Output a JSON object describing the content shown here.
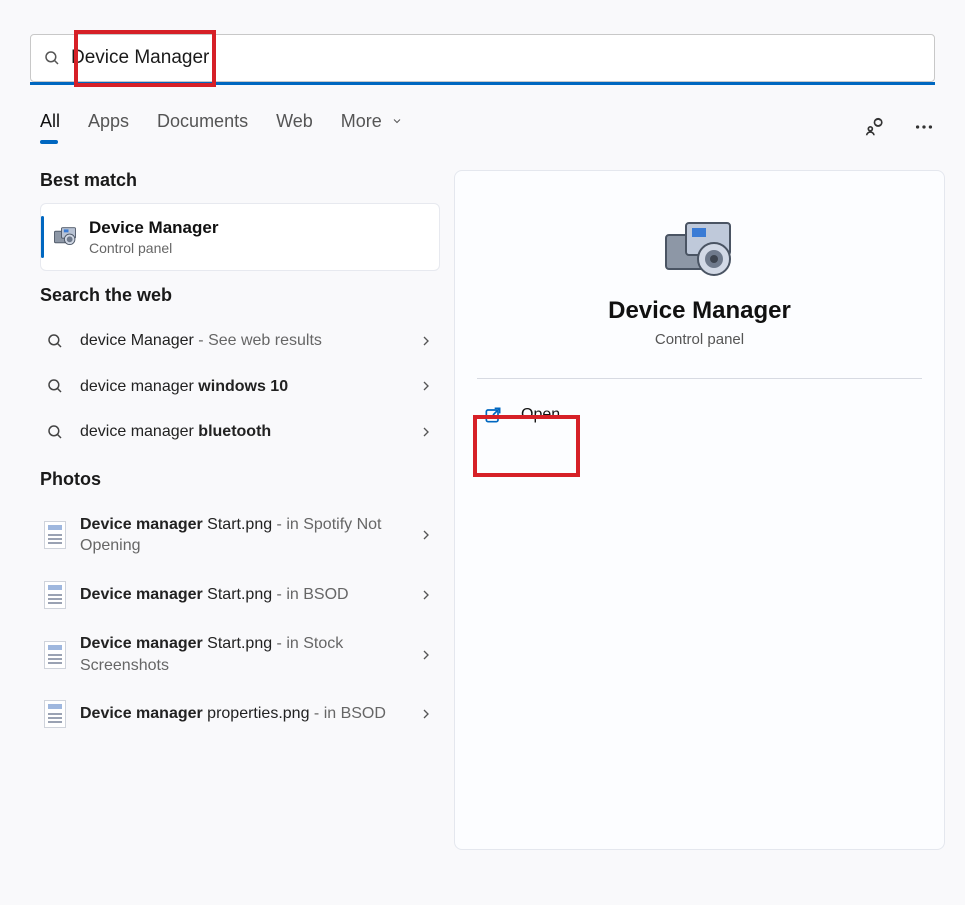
{
  "search": {
    "value": "Device Manager"
  },
  "tabs": {
    "all": "All",
    "apps": "Apps",
    "documents": "Documents",
    "web": "Web",
    "more": "More"
  },
  "aux_icons": {
    "people": "people-sync-icon",
    "more": "more-horizontal-icon"
  },
  "sections": {
    "best_match": "Best match",
    "search_web": "Search the web",
    "photos": "Photos"
  },
  "best_match": {
    "title": "Device Manager",
    "subtitle": "Control panel"
  },
  "web_results": [
    {
      "prefix": "device Manager",
      "bold": "",
      "suffix": " - See web results"
    },
    {
      "prefix": "device manager ",
      "bold": "windows 10",
      "suffix": ""
    },
    {
      "prefix": "device manager ",
      "bold": "bluetooth",
      "suffix": ""
    }
  ],
  "photos": [
    {
      "name_bold": "Device manager",
      "name_rest": " Start.png",
      "loc": " - in Spotify Not Opening"
    },
    {
      "name_bold": "Device manager",
      "name_rest": " Start.png",
      "loc": " - in BSOD"
    },
    {
      "name_bold": "Device manager",
      "name_rest": " Start.png",
      "loc": " - in Stock Screenshots"
    },
    {
      "name_bold": "Device manager",
      "name_rest": " properties.png",
      "loc": " - in BSOD"
    }
  ],
  "preview": {
    "title": "Device Manager",
    "subtitle": "Control panel",
    "open": "Open"
  }
}
